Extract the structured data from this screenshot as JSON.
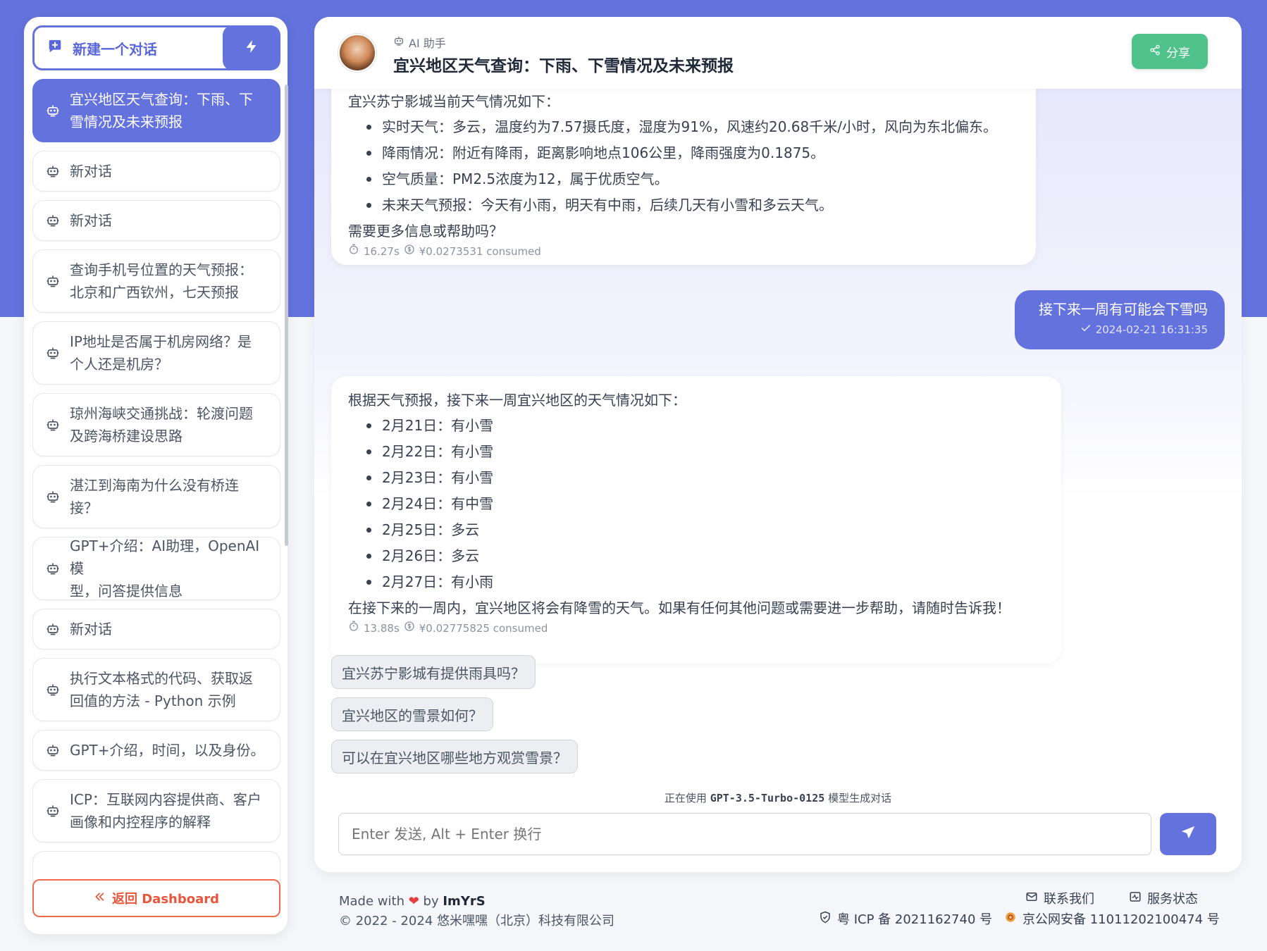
{
  "sidebar": {
    "new_chat_label": "新建一个对话",
    "conversations": [
      {
        "title": "宜兴地区天气查询：下雨、下雪情况及未来预报",
        "line1": "宜兴地区天气查询：下雨、下",
        "line2": "雪情况及未来预报",
        "active": true
      },
      {
        "title": "新对话"
      },
      {
        "title": "新对话"
      },
      {
        "line1": "查询手机号位置的天气预报：",
        "line2": "北京和广西钦州，七天预报"
      },
      {
        "line1": "IP地址是否属于机房网络？是",
        "line2": "个人还是机房？"
      },
      {
        "line1": "琼州海峡交通挑战：轮渡问题",
        "line2": "及跨海桥建设思路"
      },
      {
        "line1": "湛江到海南为什么没有桥连",
        "line2": "接？"
      },
      {
        "line1": "GPT+介绍：AI助理，OpenAI模",
        "line2": "型，问答提供信息"
      },
      {
        "title": "新对话"
      },
      {
        "line1": "执行文本格式的代码、获取返",
        "line2": "回值的方法 - Python 示例"
      },
      {
        "title": "GPT+介绍，时间，以及身份。"
      },
      {
        "line1": "ICP：互联网内容提供商、客户",
        "line2": "画像和内控程序的解释"
      }
    ],
    "back_label": "返回 Dashboard"
  },
  "header": {
    "assistant_label": "AI 助手",
    "title": "宜兴地区天气查询：下雨、下雪情况及未来预报",
    "share_label": "分享"
  },
  "messages": {
    "first_ai": {
      "intro": "宜兴苏宁影城当前天气情况如下：",
      "items": [
        "实时天气：多云，温度约为7.57摄氏度，湿度为91%，风速约20.68千米/小时，风向为东北偏东。",
        "降雨情况：附近有降雨，距离影响地点106公里，降雨强度为0.1875。",
        "空气质量：PM2.5浓度为12，属于优质空气。",
        "未来天气预报：今天有小雨，明天有中雨，后续几天有小雪和多云天气。"
      ],
      "outro": "需要更多信息或帮助吗？",
      "duration": "16.27s",
      "cost": "¥0.0273531 consumed"
    },
    "user": {
      "text": "接下来一周有可能会下雪吗",
      "time": "2024-02-21 16:31:35"
    },
    "second_ai": {
      "intro": "根据天气预报，接下来一周宜兴地区的天气情况如下：",
      "items": [
        "2月21日：有小雪",
        "2月22日：有小雪",
        "2月23日：有小雪",
        "2月24日：有中雪",
        "2月25日：多云",
        "2月26日：多云",
        "2月27日：有小雨"
      ],
      "outro": "在接下来的一周内，宜兴地区将会有降雪的天气。如果有任何其他问题或需要进一步帮助，请随时告诉我！",
      "duration": "13.88s",
      "cost": "¥0.02775825 consumed"
    }
  },
  "suggestions": [
    "宜兴苏宁影城有提供雨具吗？",
    "宜兴地区的雪景如何？",
    "可以在宜兴地区哪些地方观赏雪景？"
  ],
  "model": {
    "prefix": "正在使用",
    "name": "GPT-3.5-Turbo-0125",
    "suffix": "模型生成对话"
  },
  "input": {
    "placeholder": "Enter 发送, Alt + Enter 换行"
  },
  "footer": {
    "made_with": "Made with",
    "by": "by",
    "author": "ImYrS",
    "copyright_prefix": "© 2022 - 2024",
    "company": "悠米嘿嘿（北京）科技有限公司",
    "contact": "联系我们",
    "status": "服务状态",
    "icp": "粤 ICP 备 2021162740 号",
    "police": "京公网安备 11011202100474 号"
  },
  "colors": {
    "primary": "#6472dd",
    "share_green": "#4fc38b",
    "back_orange": "#e8553a"
  }
}
